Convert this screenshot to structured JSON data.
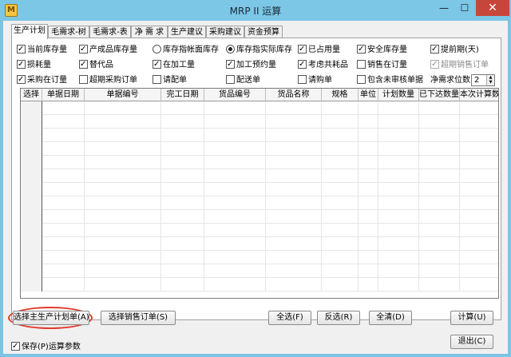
{
  "window": {
    "title": "MRP II 运算",
    "icon_label": "M",
    "minimize_glyph": "—",
    "maximize_glyph": "☐",
    "close_glyph": "✕"
  },
  "tabs": [
    {
      "label": "生产计划",
      "active": true
    },
    {
      "label": "毛需求-树",
      "active": false
    },
    {
      "label": "毛需求-表",
      "active": false
    },
    {
      "label": "净 需 求",
      "active": false
    },
    {
      "label": "生产建议",
      "active": false
    },
    {
      "label": "采购建议",
      "active": false
    },
    {
      "label": "资金预算",
      "active": false
    }
  ],
  "options": {
    "row1": [
      {
        "label": "当前库存量",
        "type": "checkbox",
        "checked": true
      },
      {
        "label": "产成品库存量",
        "type": "checkbox",
        "checked": true
      },
      {
        "label": "库存指帐面库存",
        "type": "radio",
        "checked": false
      },
      {
        "label": "库存指实际库存",
        "type": "radio",
        "checked": true
      },
      {
        "label": "已占用量",
        "type": "checkbox",
        "checked": true
      },
      {
        "label": "安全库存量",
        "type": "checkbox",
        "checked": true
      },
      {
        "label": "提前期(天)",
        "type": "checkbox",
        "checked": true
      }
    ],
    "row2": [
      {
        "label": "损耗量",
        "type": "checkbox",
        "checked": true
      },
      {
        "label": "替代品",
        "type": "checkbox",
        "checked": true
      },
      {
        "label": "在加工量",
        "type": "checkbox",
        "checked": true
      },
      {
        "label": "加工预约量",
        "type": "checkbox",
        "checked": true
      },
      {
        "label": "考虑共耗品",
        "type": "checkbox",
        "checked": true
      },
      {
        "label": "销售在订量",
        "type": "checkbox",
        "checked": false
      },
      {
        "label": "超期销售订单",
        "type": "checkbox",
        "checked": true,
        "disabled": true
      }
    ],
    "row3": [
      {
        "label": "采购在订量",
        "type": "checkbox",
        "checked": true
      },
      {
        "label": "超期采购订单",
        "type": "checkbox",
        "checked": false
      },
      {
        "label": "请配单",
        "type": "checkbox",
        "checked": false
      },
      {
        "label": "配送单",
        "type": "checkbox",
        "checked": false
      },
      {
        "label": "请购单",
        "type": "checkbox",
        "checked": false
      },
      {
        "label": "包含未审核单据",
        "type": "checkbox",
        "checked": false
      }
    ],
    "precision_label": "净需求位数",
    "precision_value": "2",
    "spin_up": "▲",
    "spin_down": "▼"
  },
  "grid": {
    "columns": [
      "选择",
      "单据日期",
      "单据编号",
      "完工日期",
      "货品编号",
      "货品名称",
      "规格",
      "单位",
      "计划数量",
      "已下达数量",
      "本次计算数量"
    ],
    "row_count": 14
  },
  "buttons": {
    "select_master_plan": "选择主生产计划单(A)",
    "select_sales_order": "选择销售订单(S)",
    "select_all": "全选(F)",
    "invert": "反选(R)",
    "clear_all": "全清(D)",
    "compute": "计算(U)",
    "exit": "退出(C)"
  },
  "save_params": {
    "label": "保存(P)运算参数",
    "checked": true
  }
}
